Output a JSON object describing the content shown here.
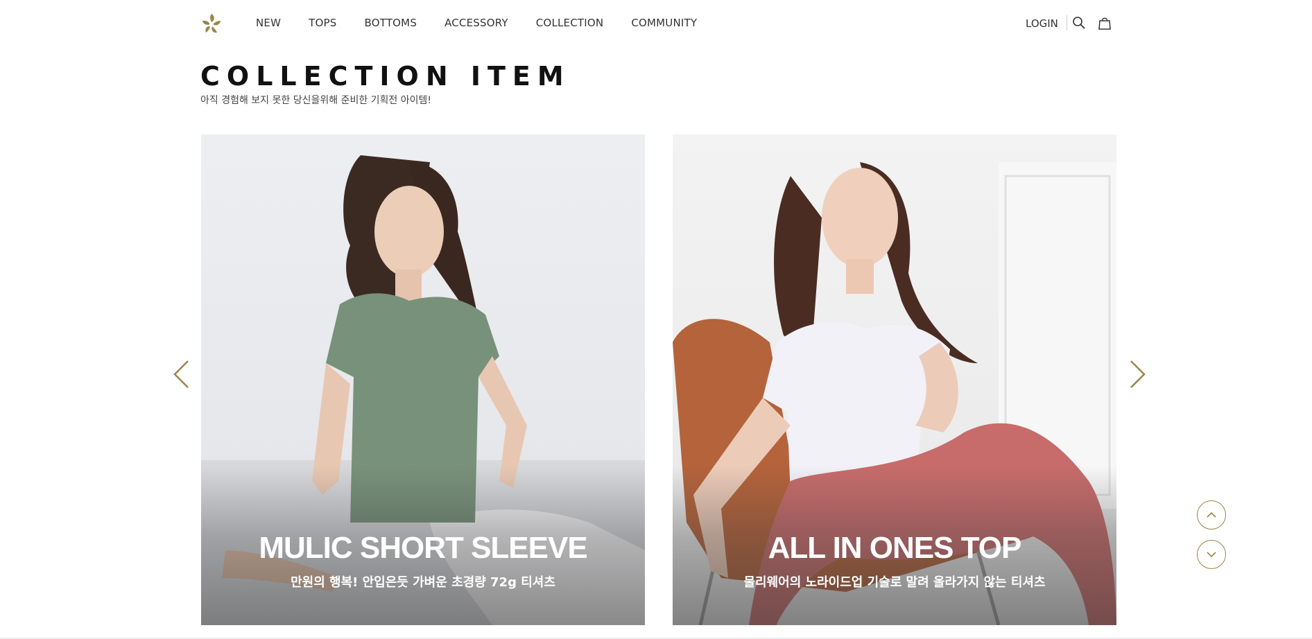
{
  "header": {
    "logo_icon": "flower-logo-icon",
    "nav": [
      "NEW",
      "TOPS",
      "BOTTOMS",
      "ACCESSORY",
      "COLLECTION",
      "COMMUNITY"
    ],
    "login_label": "LOGIN",
    "search_icon": "search-icon",
    "bag_icon": "shopping-bag-icon"
  },
  "section": {
    "title": "COLLECTION ITEM",
    "subtitle": "아직 경험해 보지 못한 당신을위해 준비한 기획전 아이템!"
  },
  "cards": [
    {
      "title": "MULIC SHORT SLEEVE",
      "desc": "만원의 행복! 안입은듯 가벼운 초경량 72g 티셔츠"
    },
    {
      "title": "ALL IN ONES TOP",
      "desc": "물리웨어의 노라이드업 기술로 말려 올라가지 않는 티셔츠"
    }
  ],
  "colors": {
    "accent": "#9b8447",
    "text": "#222222"
  }
}
